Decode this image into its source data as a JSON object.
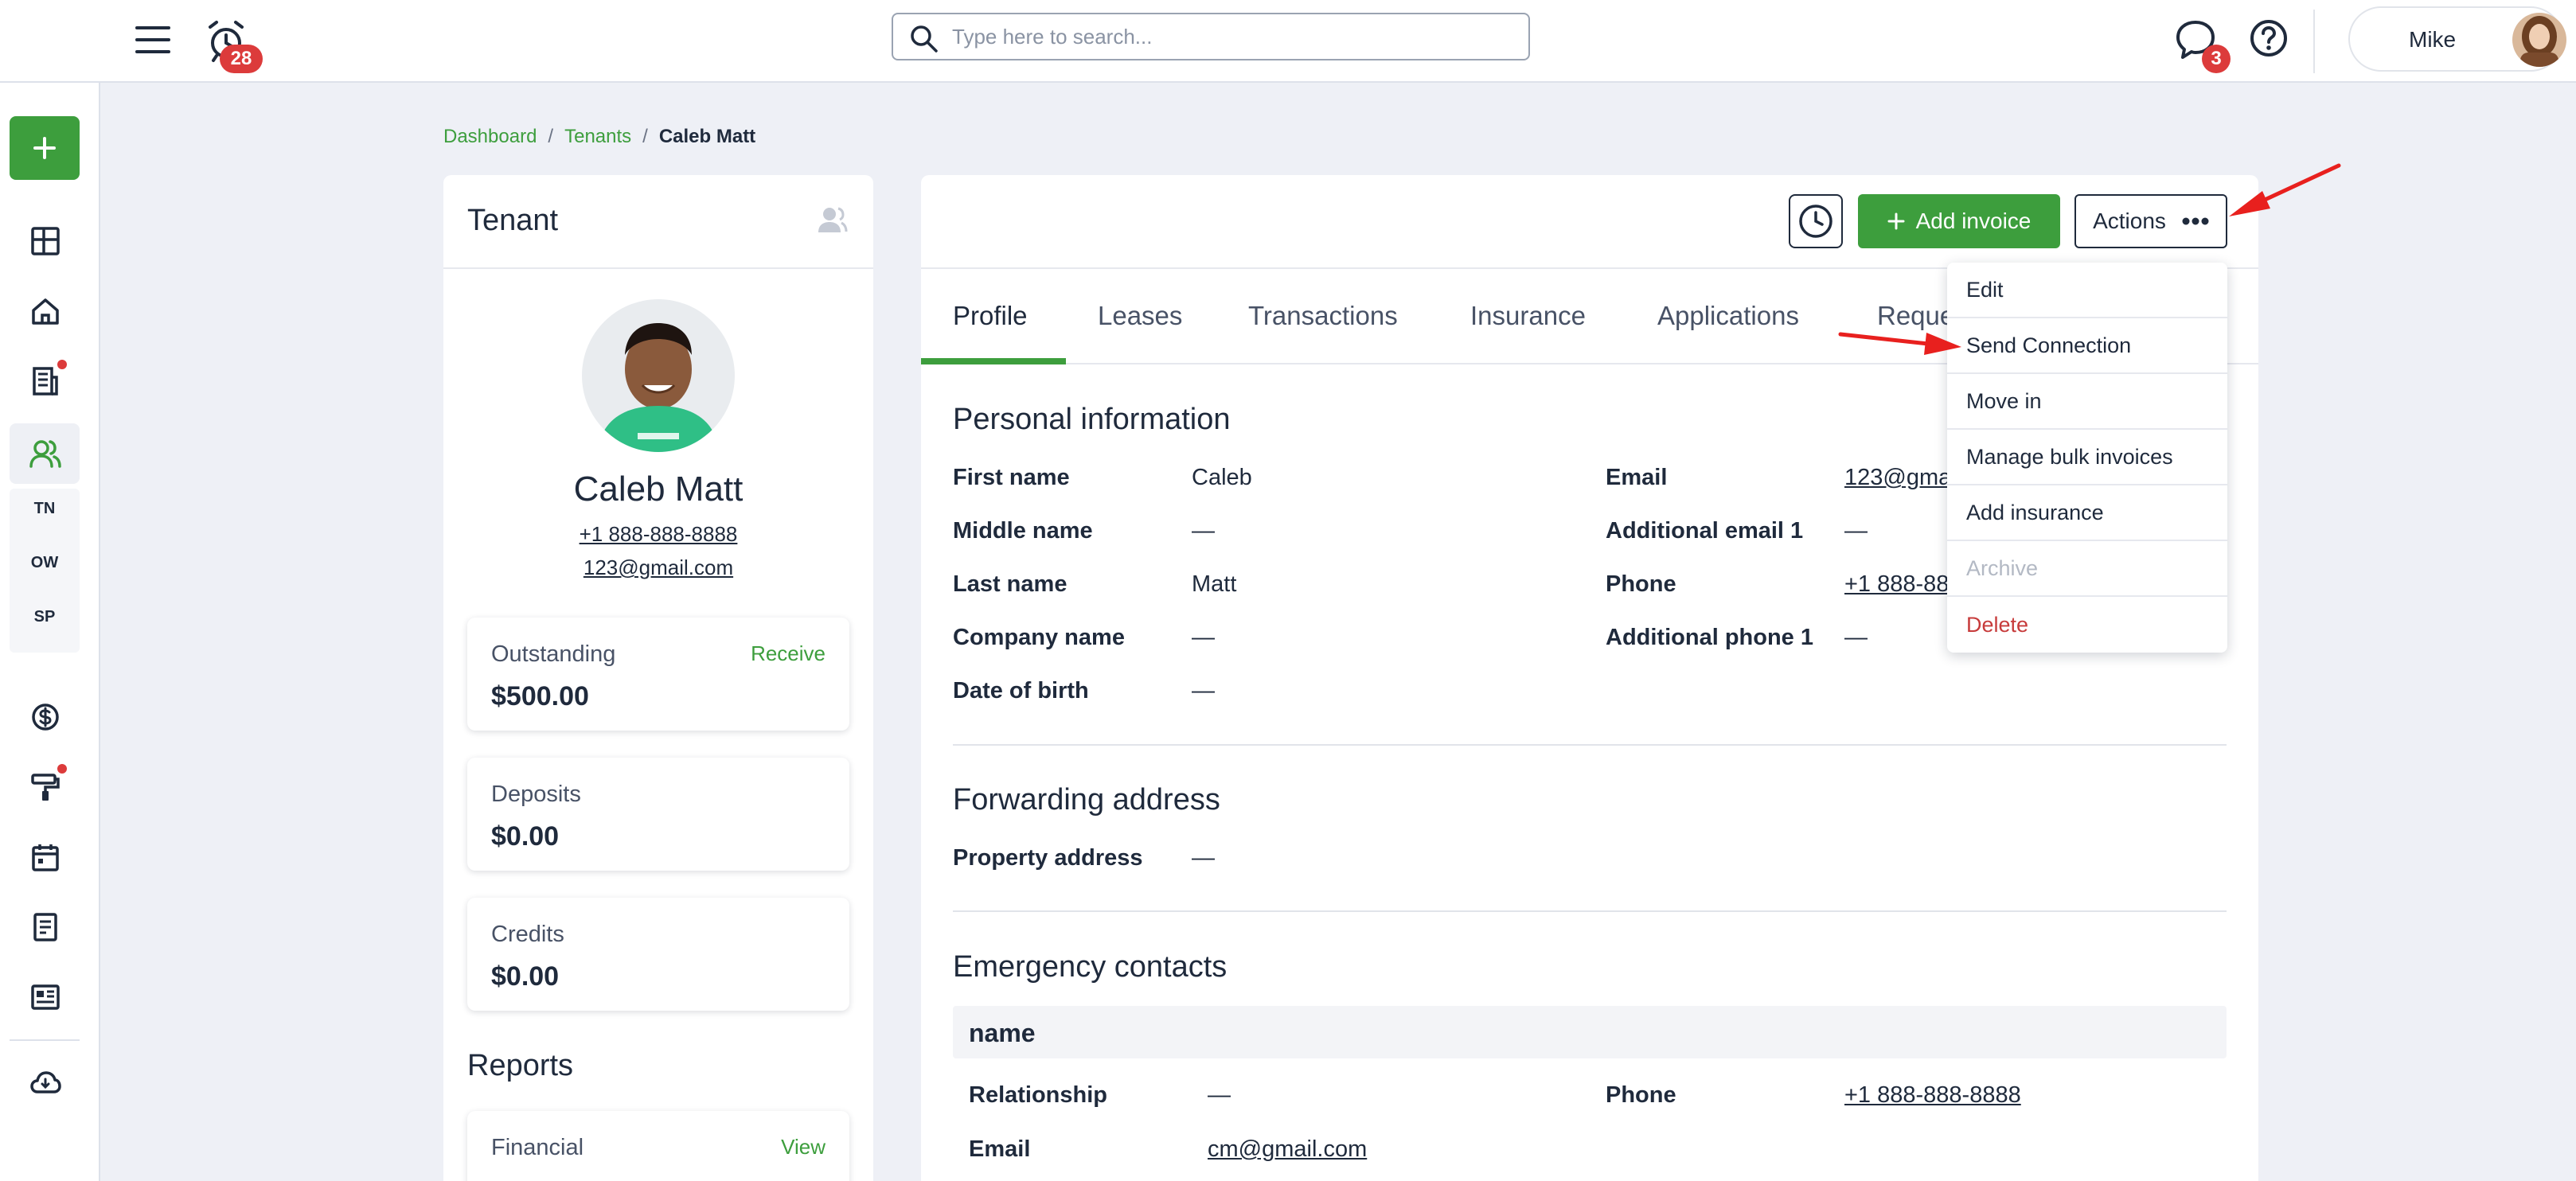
{
  "topbar": {
    "alarm_count": "28",
    "search_placeholder": "Type here to search...",
    "chat_count": "3",
    "user_name": "Mike"
  },
  "sidebar": {
    "sub_items": [
      "TN",
      "OW",
      "SP"
    ]
  },
  "breadcrumb": {
    "items": [
      "Dashboard",
      "Tenants"
    ],
    "current": "Caleb Matt",
    "separator": "/"
  },
  "tenant": {
    "title": "Tenant",
    "name": "Caleb Matt",
    "phone": "+1 888-888-8888",
    "email": "123@gmail.com",
    "stats": [
      {
        "label": "Outstanding",
        "value": "$500.00",
        "link": "Receive"
      },
      {
        "label": "Deposits",
        "value": "$0.00",
        "link": ""
      },
      {
        "label": "Credits",
        "value": "$0.00",
        "link": ""
      }
    ],
    "reports_title": "Reports",
    "report_item": {
      "label": "Financial",
      "link": "View"
    }
  },
  "main": {
    "add_invoice_label": "Add invoice",
    "actions_label": "Actions",
    "tabs": [
      "Profile",
      "Leases",
      "Transactions",
      "Insurance",
      "Applications",
      "Reque"
    ],
    "active_tab": "Profile",
    "personal": {
      "title": "Personal information",
      "left": [
        {
          "label": "First name",
          "value": "Caleb"
        },
        {
          "label": "Middle name",
          "value": "—"
        },
        {
          "label": "Last name",
          "value": "Matt"
        },
        {
          "label": "Company name",
          "value": "—"
        },
        {
          "label": "Date of birth",
          "value": "—"
        }
      ],
      "right": [
        {
          "label": "Email",
          "value": "123@gma"
        },
        {
          "label": "Additional email 1",
          "value": "—"
        },
        {
          "label": "Phone",
          "value": "+1 888-88"
        },
        {
          "label": "Additional phone 1",
          "value": "—"
        }
      ]
    },
    "forwarding": {
      "title": "Forwarding address",
      "label": "Property address",
      "value": "—"
    },
    "emergency": {
      "title": "Emergency contacts",
      "name_header": "name",
      "relationship_label": "Relationship",
      "relationship_value": "—",
      "phone_label": "Phone",
      "phone_value": "+1 888-888-8888",
      "email_label": "Email",
      "email_value": "cm@gmail.com"
    }
  },
  "actions_menu": {
    "items": [
      {
        "label": "Edit",
        "state": "normal"
      },
      {
        "label": "Send Connection",
        "state": "normal"
      },
      {
        "label": "Move in",
        "state": "normal"
      },
      {
        "label": "Manage bulk invoices",
        "state": "normal"
      },
      {
        "label": "Add insurance",
        "state": "normal"
      },
      {
        "label": "Archive",
        "state": "disabled"
      },
      {
        "label": "Delete",
        "state": "danger"
      }
    ]
  },
  "colors": {
    "brand_green": "#3d9e3d",
    "badge_red": "#dc3b3b",
    "danger_red": "#c73b3b",
    "background": "#eef0f6",
    "annotation_arrow": "#e8201e"
  },
  "icons": [
    "hamburger-menu-icon",
    "alarm-clock-icon",
    "search-icon",
    "chat-bubble-icon",
    "help-circle-icon",
    "plus-icon",
    "dashboard-grid-icon",
    "home-icon",
    "building-icon",
    "people-icon",
    "dollar-circle-icon",
    "paint-roller-icon",
    "calendar-icon",
    "document-icon",
    "listing-icon",
    "cloud-download-icon",
    "user-icon",
    "clock-icon",
    "more-dots-icon"
  ]
}
